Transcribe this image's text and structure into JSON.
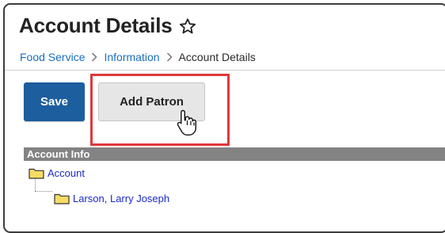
{
  "page": {
    "title": "Account Details"
  },
  "breadcrumb": [
    "Food Service",
    "Information",
    "Account Details"
  ],
  "toolbar": {
    "save_label": "Save",
    "add_patron_label": "Add Patron"
  },
  "panel": {
    "header": "Account Info",
    "tree": {
      "root": "Account",
      "child": "Larson, Larry Joseph"
    }
  },
  "icons": [
    "star-outline-icon",
    "chevron-right-icon",
    "folder-icon",
    "hand-pointer-cursor-icon"
  ],
  "colors": {
    "primary": "#1d5e9e",
    "link": "#1a6ec1",
    "highlight": "#e0383b",
    "panel_header": "#838383"
  }
}
